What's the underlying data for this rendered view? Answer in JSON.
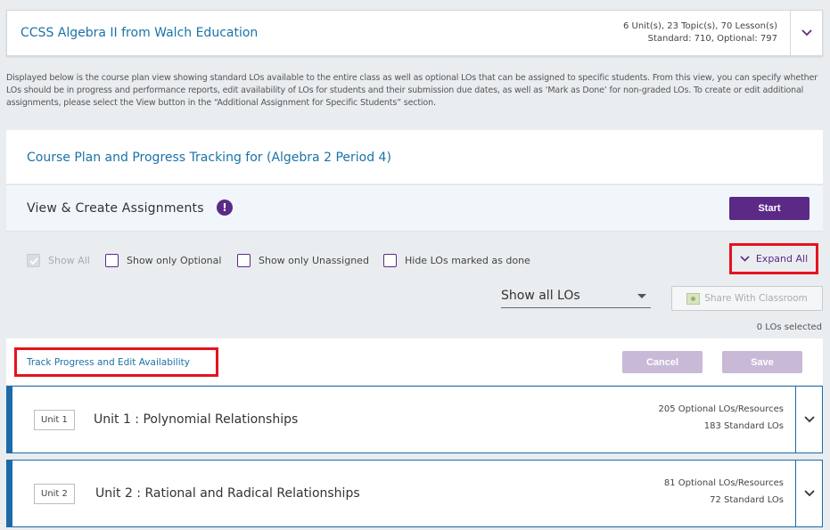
{
  "course": {
    "title": "CCSS Algebra II from Walch Education",
    "summary_line1": "6 Unit(s), 23 Topic(s), 70 Lesson(s)",
    "summary_line2": "Standard: 710, Optional: 797"
  },
  "description": "Displayed below is the course plan view showing standard LOs available to the entire class as well as optional LOs that can be assigned to specific students. From this view, you can specify whether LOs should be in progress and performance reports, edit availability of LOs for students and their submission due dates, as well as ‘Mark as Done’ for non-graded LOs. To create or edit additional assignments, please select the View button in the “Additional Assignment for Specific Students” section.",
  "plan": {
    "title": "Course Plan and Progress Tracking for (Algebra 2 Period 4)"
  },
  "assignments": {
    "title": "View & Create Assignments",
    "info_glyph": "!",
    "start_label": "Start"
  },
  "filters": {
    "show_all": "Show All",
    "show_optional": "Show only Optional",
    "show_unassigned": "Show only Unassigned",
    "hide_done": "Hide LOs marked as done",
    "expand_all": "Expand All"
  },
  "lo_select": {
    "value": "Show all LOs"
  },
  "share_label": "Share With Classroom",
  "los_selected": "0 LOs selected",
  "track": {
    "link_label": "Track Progress and Edit Availability",
    "cancel_label": "Cancel",
    "save_label": "Save"
  },
  "units": [
    {
      "badge": "Unit 1",
      "name": "Unit 1 : Polynomial Relationships",
      "optional": "205 Optional LOs/Resources",
      "standard": "183 Standard LOs"
    },
    {
      "badge": "Unit 2",
      "name": "Unit 2 : Rational and Radical Relationships",
      "optional": "81 Optional LOs/Resources",
      "standard": "72 Standard LOs"
    }
  ],
  "colors": {
    "brand_purple": "#5b2a86",
    "link_blue": "#1a73a8",
    "highlight_red": "#e4131f",
    "unit_border": "#1d6aa8"
  }
}
